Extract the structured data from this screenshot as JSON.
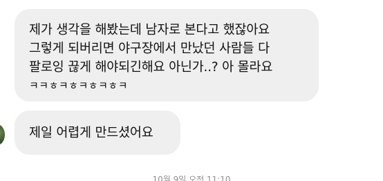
{
  "messages": [
    {
      "lines": [
        "제가 생각을 해봤는데 남자로 본다고 했잖아요",
        "그렇게 되버리면 야구장에서 만났던 사람들 다",
        "팔로잉 끊게 해야되긴해요 아닌가..? 아 몰라요",
        "ㅋㅋㅎㅋㅎㅋㅎㅋㅎㅋ"
      ]
    },
    {
      "lines": [
        "제일 어렵게 만드셨어요"
      ]
    }
  ],
  "timestamp": "10월 9일 오전 11:10"
}
